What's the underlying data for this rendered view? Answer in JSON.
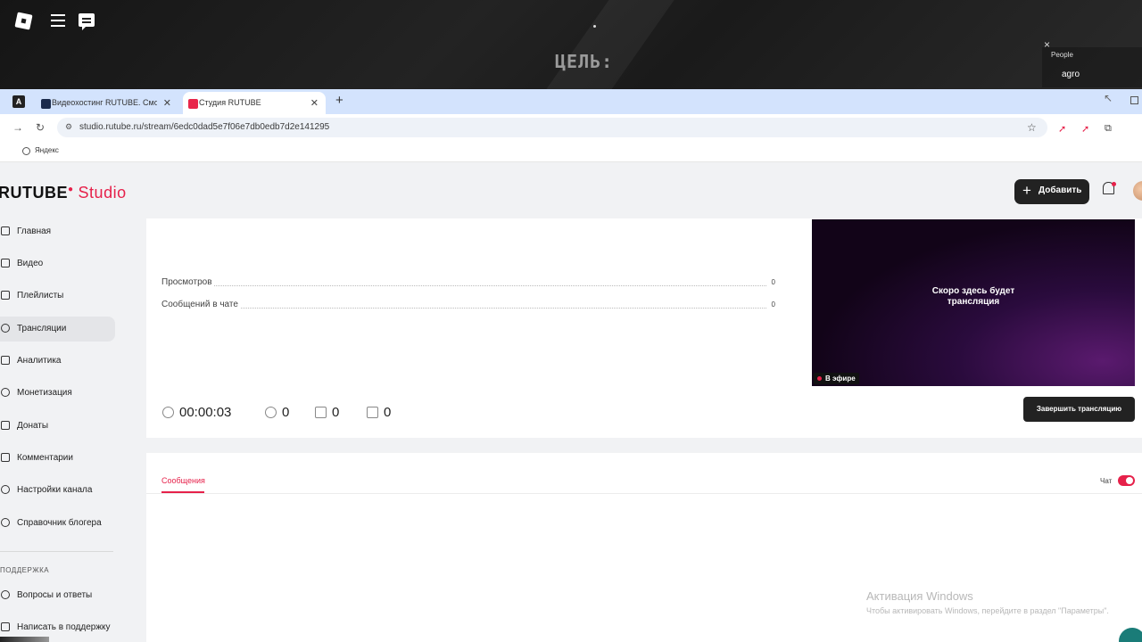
{
  "game_overlay": {
    "goal_text": "ЦЕЛЬ:",
    "people_title": "People",
    "people_list": [
      "agro"
    ],
    "close_glyph": "×"
  },
  "browser": {
    "tabs": [
      {
        "label": "A",
        "active": false
      },
      {
        "label": "Видеохостинг RUTUBE. Смотр",
        "active": false
      },
      {
        "label": "Студия RUTUBE",
        "active": true
      }
    ],
    "new_tab_glyph": "+",
    "url": "studio.rutube.ru/stream/6edc0dad5e7f06e7db0edb7d2e141295",
    "bookmarks": [
      "Яндекс"
    ]
  },
  "header": {
    "logo_main": "RUTUBE",
    "logo_studio": "Studio",
    "add_button": "Добавить"
  },
  "sidebar": {
    "items": [
      {
        "label": "Главная",
        "icon": "home-icon"
      },
      {
        "label": "Видео",
        "icon": "video-icon"
      },
      {
        "label": "Плейлисты",
        "icon": "playlist-icon"
      },
      {
        "label": "Трансляции",
        "icon": "broadcast-icon",
        "active": true
      },
      {
        "label": "Аналитика",
        "icon": "analytics-icon"
      },
      {
        "label": "Монетизация",
        "icon": "ruble-icon"
      },
      {
        "label": "Донаты",
        "icon": "wallet-icon"
      },
      {
        "label": "Комментарии",
        "icon": "comment-icon"
      },
      {
        "label": "Настройки канала",
        "icon": "gear-icon"
      },
      {
        "label": "Справочник блогера",
        "icon": "info-icon"
      }
    ],
    "support_section": "ПОДДЕРЖКА",
    "support_items": [
      {
        "label": "Вопросы и ответы",
        "icon": "question-icon"
      },
      {
        "label": "Написать в поддержку",
        "icon": "mail-icon"
      }
    ]
  },
  "stream": {
    "stats": [
      {
        "label": "Просмотров",
        "value": "0"
      },
      {
        "label": "Сообщений в чате",
        "value": "0"
      }
    ],
    "preview_text_line1": "Скоро здесь будет",
    "preview_text_line2": "трансляция",
    "live_badge": "В эфире",
    "duration": "00:00:03",
    "viewers": "0",
    "likes": "0",
    "dislikes": "0",
    "end_button": "Завершить трансляцию"
  },
  "chat": {
    "messages_tab": "Сообщения",
    "chat_label": "Чат",
    "chat_enabled": true
  },
  "os_watermark": {
    "title": "Активация Windows",
    "subtitle": "Чтобы активировать Windows, перейдите в раздел \"Параметры\"."
  },
  "colors": {
    "accent": "#e6214a",
    "dark_button": "#222222",
    "tab_strip": "#d3e3fd"
  }
}
